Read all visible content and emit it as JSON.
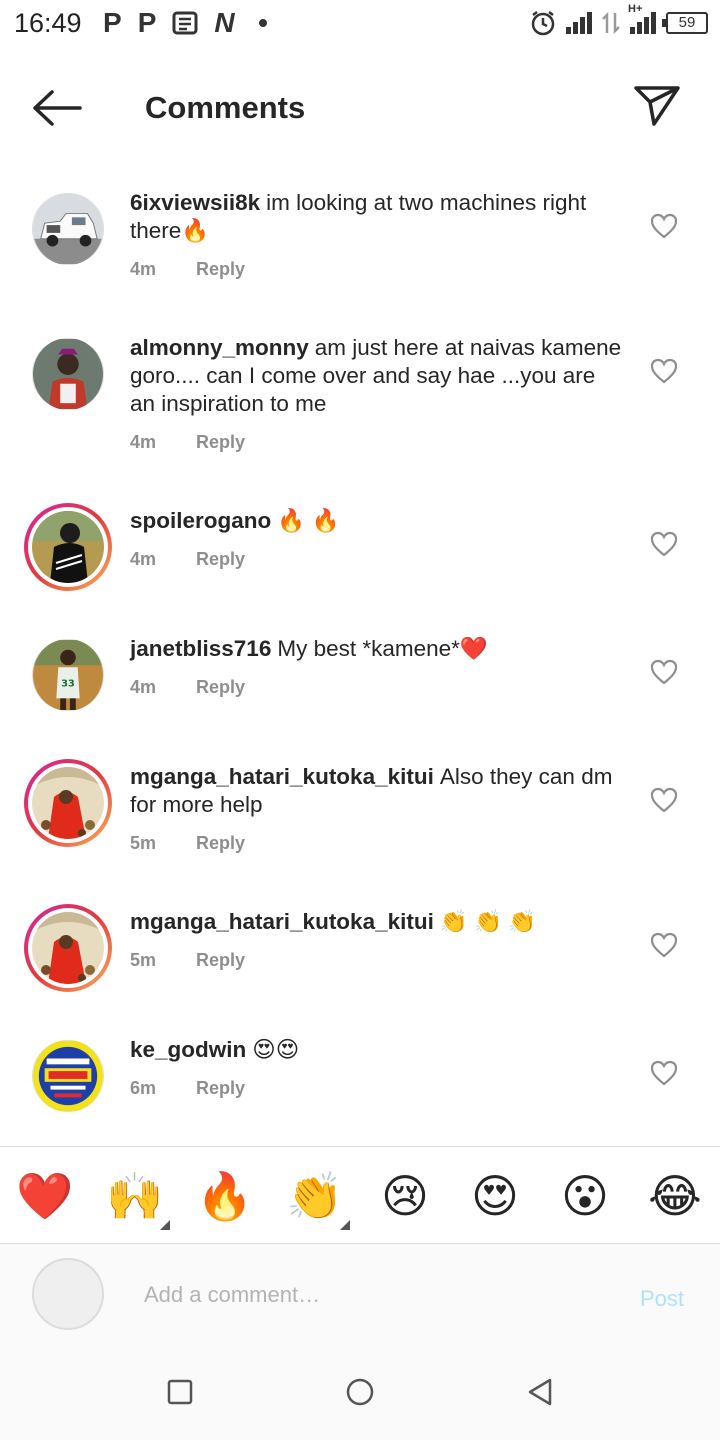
{
  "status_bar": {
    "time": "16:49",
    "left_icons": [
      "P",
      "P",
      "news-icon",
      "N"
    ],
    "battery": "59",
    "network": "H+"
  },
  "header": {
    "title": "Comments"
  },
  "comments": [
    {
      "username": "6ixviewsii8k",
      "text": "im looking at two machines right there🔥",
      "time": "4m",
      "reply": "Reply",
      "story_ring": false,
      "avatar": "white-truck-avatar"
    },
    {
      "username": "almonny_monny",
      "text": "am just here at naivas kamene goro.... can I come over and say hae ...you are an inspiration to me",
      "time": "4m",
      "reply": "Reply",
      "story_ring": false,
      "avatar": "person-avatar"
    },
    {
      "username": "spoilerogano",
      "text": "🔥 🔥",
      "time": "4m",
      "reply": "Reply",
      "story_ring": true,
      "avatar": "person-dark-avatar"
    },
    {
      "username": "janetbliss716",
      "text": "My best *kamene*❤️",
      "time": "4m",
      "reply": "Reply",
      "story_ring": false,
      "avatar": "person-jersey-avatar"
    },
    {
      "username": "mganga_hatari_kutoka_kitui",
      "text": "Also they can dm for more help",
      "time": "5m",
      "reply": "Reply",
      "story_ring": true,
      "avatar": "red-robe-avatar"
    },
    {
      "username": "mganga_hatari_kutoka_kitui",
      "text": "👏 👏 👏",
      "time": "5m",
      "reply": "Reply",
      "story_ring": true,
      "avatar": "red-robe-avatar"
    },
    {
      "username": "ke_godwin",
      "text": "😍😍",
      "time": "6m",
      "reply": "Reply",
      "story_ring": false,
      "avatar": "yellow-poster-avatar"
    }
  ],
  "emoji_bar": [
    "❤️",
    "🙌",
    "🔥",
    "👏",
    "😢",
    "😍",
    "😮",
    "😂"
  ],
  "comment_input": {
    "placeholder": "Add a comment…",
    "post_label": "Post"
  },
  "colors": {
    "story_ring_start": "#d6249f",
    "story_ring_end": "#fdb35a",
    "post_disabled": "#b2dffc",
    "meta_gray": "#8e8e8e"
  }
}
